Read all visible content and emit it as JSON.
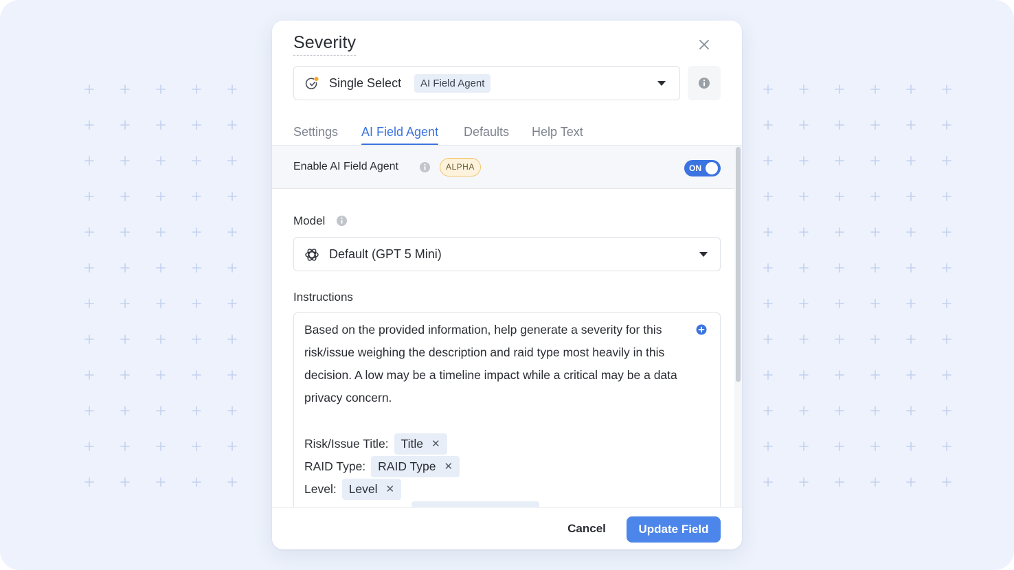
{
  "dialog": {
    "title": "Severity",
    "field_type": {
      "label": "Single Select",
      "badge": "AI Field Agent",
      "icon": "single-select-icon"
    },
    "tabs": [
      {
        "label": "Settings",
        "active": false
      },
      {
        "label": "AI Field Agent",
        "active": true
      },
      {
        "label": "Defaults",
        "active": false
      },
      {
        "label": "Help Text",
        "active": false
      }
    ],
    "enable": {
      "label": "Enable AI Field Agent",
      "badge": "ALPHA",
      "toggle_text": "ON",
      "toggle_on": true
    },
    "model": {
      "label": "Model",
      "value": "Default (GPT 5 Mini)",
      "icon": "openai-icon"
    },
    "instructions": {
      "label": "Instructions",
      "text": "Based on the provided information, help generate a severity for this risk/issue weighing the description and raid type most heavily in this decision.  A low may be a timeline impact while a critical may be a data privacy concern.",
      "variables": [
        {
          "label": "Risk/Issue Title:",
          "chip": "Title"
        },
        {
          "label": "RAID Type:",
          "chip": "RAID Type"
        },
        {
          "label": "Level:",
          "chip": "Level"
        }
      ]
    },
    "footer": {
      "cancel_label": "Cancel",
      "update_label": "Update Field"
    },
    "colors": {
      "accent": "#3b74e0",
      "primary_button": "#4c86ea",
      "background": "#edf2fc",
      "alpha_badge_border": "#f2c56b"
    }
  }
}
